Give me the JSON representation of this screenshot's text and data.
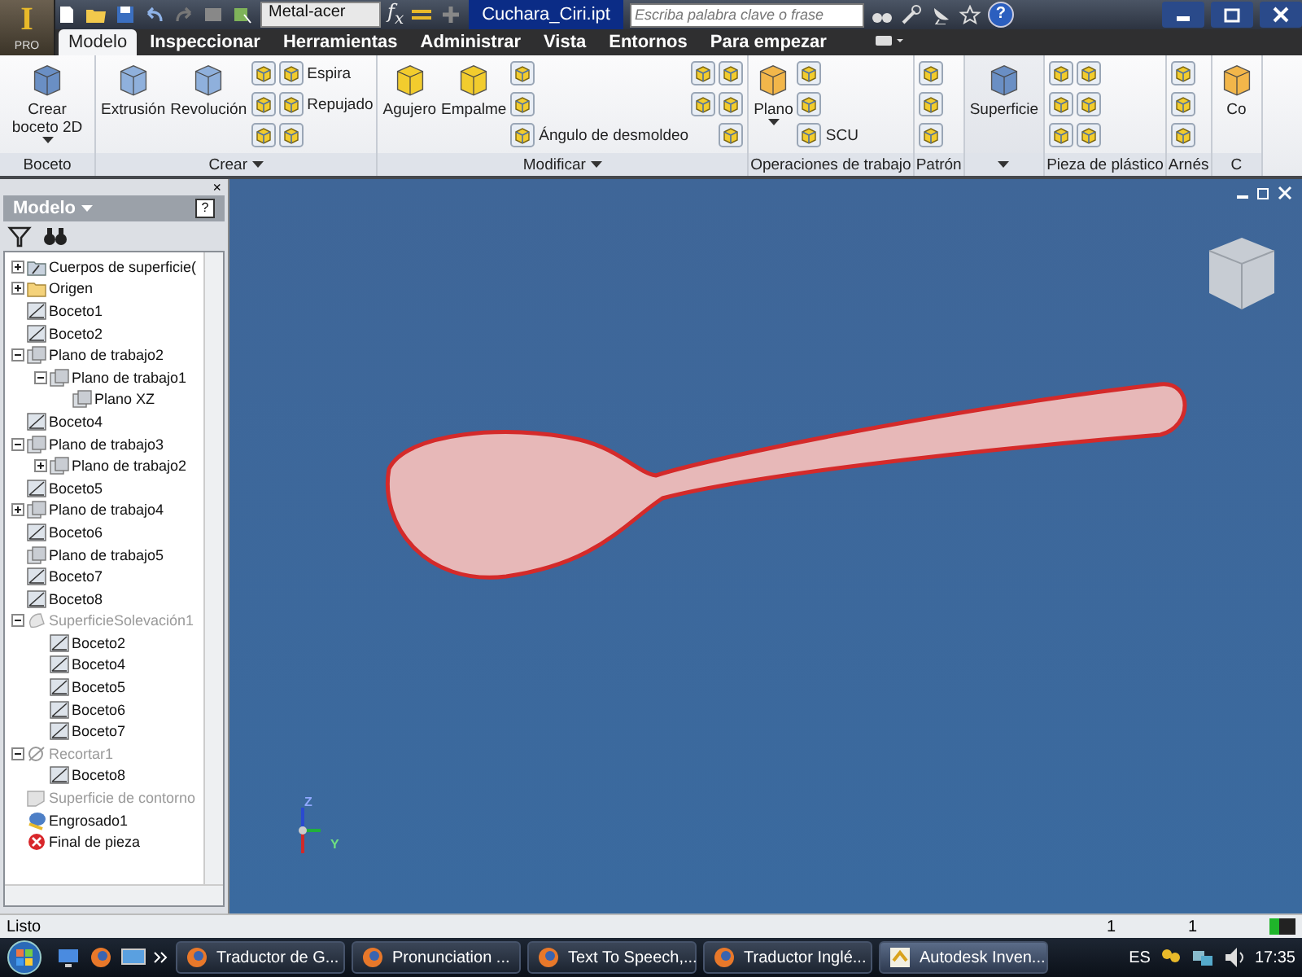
{
  "title_bar": {
    "app_logo": "I",
    "app_badge": "PRO",
    "material": "Metal-acer",
    "formula": "f$_{x}$",
    "title": "Cuchara_Ciri.ipt",
    "search": {
      "placeholder": "Escriba palabra clave o frase"
    },
    "help": "?"
  },
  "tabs": [
    {
      "label": "Modelo",
      "selected": true
    },
    {
      "label": "Inspeccionar",
      "selected": false
    },
    {
      "label": "Herramientas",
      "selected": false
    },
    {
      "label": "Administrar",
      "selected": false
    },
    {
      "label": "Vista",
      "selected": false
    },
    {
      "label": "Entornos",
      "selected": false
    },
    {
      "label": "Para empezar",
      "selected": false
    }
  ],
  "ribbon": [
    {
      "label": "Boceto",
      "menu": false,
      "highlight": false,
      "columns": [
        [
          {
            "kind": "large",
            "label": "Crear boceto 2D",
            "dropdown": true
          }
        ]
      ]
    },
    {
      "label": "Crear",
      "menu": true,
      "highlight": false,
      "columns": [
        [
          {
            "kind": "large",
            "label": "Extrusión",
            "dropdown": false
          }
        ],
        [
          {
            "kind": "large",
            "label": "Revolución",
            "dropdown": false
          }
        ],
        [
          {
            "kind": "icon"
          },
          {
            "kind": "icon"
          },
          {
            "kind": "icon"
          }
        ],
        [
          {
            "kind": "small",
            "label": "Espira"
          },
          {
            "kind": "small",
            "label": "Repujado"
          },
          {
            "kind": "icon"
          }
        ]
      ]
    },
    {
      "label": "Modificar",
      "menu": true,
      "highlight": false,
      "columns": [
        [
          {
            "kind": "large",
            "label": "Agujero",
            "dropdown": false
          }
        ],
        [
          {
            "kind": "large",
            "label": "Empalme",
            "dropdown": false
          }
        ],
        [
          {
            "kind": "icon"
          },
          {
            "kind": "icon"
          },
          {
            "kind": "small",
            "label": "Ángulo de desmoldeo"
          }
        ],
        [
          {
            "kind": "icon"
          },
          {
            "kind": "icon"
          }
        ],
        [
          {
            "kind": "icon"
          },
          {
            "kind": "icon"
          },
          {
            "kind": "icon"
          }
        ]
      ]
    },
    {
      "label": "Operaciones de trabajo",
      "menu": false,
      "highlight": false,
      "columns": [
        [
          {
            "kind": "large",
            "label": "Plano",
            "dropdown": true
          }
        ],
        [
          {
            "kind": "icon"
          },
          {
            "kind": "icon"
          },
          {
            "kind": "small",
            "label": "SCU"
          }
        ]
      ]
    },
    {
      "label": "Patrón",
      "menu": false,
      "highlight": false,
      "columns": [
        [
          {
            "kind": "icon"
          },
          {
            "kind": "icon"
          },
          {
            "kind": "icon"
          }
        ]
      ]
    },
    {
      "menu": true,
      "highlight": true,
      "columns": [
        [
          {
            "kind": "large",
            "label": "Superficie",
            "dropdown": false
          }
        ]
      ]
    },
    {
      "label": "Pieza de plástico",
      "menu": false,
      "highlight": false,
      "columns": [
        [
          {
            "kind": "icon"
          },
          {
            "kind": "icon"
          },
          {
            "kind": "icon"
          }
        ],
        [
          {
            "kind": "icon"
          },
          {
            "kind": "icon"
          },
          {
            "kind": "icon"
          }
        ]
      ]
    },
    {
      "label": "Arnés",
      "menu": false,
      "highlight": false,
      "columns": [
        [
          {
            "kind": "icon"
          },
          {
            "kind": "icon"
          },
          {
            "kind": "icon"
          }
        ]
      ]
    },
    {
      "label": "C",
      "menu": false,
      "highlight": false,
      "columns": [
        [
          {
            "kind": "large",
            "label": "Co",
            "dropdown": false
          }
        ]
      ]
    }
  ],
  "browser": {
    "close": "×",
    "title": "Modelo",
    "help": "?",
    "tree": [
      {
        "label": "Cuerpos de superficie(",
        "kind": "bodies",
        "disabled": false,
        "expanded": false
      },
      {
        "label": "Origen",
        "kind": "folder",
        "disabled": false,
        "expanded": false
      },
      {
        "label": "Boceto1",
        "kind": "sketch",
        "disabled": false
      },
      {
        "label": "Boceto2",
        "kind": "sketch",
        "disabled": false
      },
      {
        "label": "Plano de trabajo2",
        "kind": "plane",
        "disabled": false,
        "expanded": true,
        "children": [
          {
            "label": "Plano de trabajo1",
            "kind": "plane",
            "disabled": false,
            "expanded": true,
            "children": [
              {
                "label": "Plano XZ",
                "kind": "plane",
                "disabled": false
              }
            ]
          }
        ]
      },
      {
        "label": "Boceto4",
        "kind": "sketch",
        "disabled": false
      },
      {
        "label": "Plano de trabajo3",
        "kind": "plane",
        "disabled": false,
        "expanded": true,
        "children": [
          {
            "label": "Plano de trabajo2",
            "kind": "plane",
            "disabled": false,
            "expanded": false
          }
        ]
      },
      {
        "label": "Boceto5",
        "kind": "sketch",
        "disabled": false
      },
      {
        "label": "Plano de trabajo4",
        "kind": "plane",
        "disabled": false,
        "expanded": false
      },
      {
        "label": "Boceto6",
        "kind": "sketch",
        "disabled": false
      },
      {
        "label": "Plano de trabajo5",
        "kind": "plane",
        "disabled": false
      },
      {
        "label": "Boceto7",
        "kind": "sketch",
        "disabled": false
      },
      {
        "label": "Boceto8",
        "kind": "sketch",
        "disabled": false
      },
      {
        "label": "SuperficieSolevación1",
        "kind": "loft",
        "disabled": true,
        "expanded": true,
        "children": [
          {
            "label": "Boceto2",
            "kind": "sketch",
            "disabled": false
          },
          {
            "label": "Boceto4",
            "kind": "sketch",
            "disabled": false
          },
          {
            "label": "Boceto5",
            "kind": "sketch",
            "disabled": false
          },
          {
            "label": "Boceto6",
            "kind": "sketch",
            "disabled": false
          },
          {
            "label": "Boceto7",
            "kind": "sketch",
            "disabled": false
          }
        ]
      },
      {
        "label": "Recortar1",
        "kind": "trim",
        "disabled": true,
        "expanded": true,
        "children": [
          {
            "label": "Boceto8",
            "kind": "sketch",
            "disabled": false
          }
        ]
      },
      {
        "label": "Superficie de contorno",
        "kind": "surface",
        "disabled": true
      },
      {
        "label": "Engrosado1",
        "kind": "thicken",
        "disabled": false
      },
      {
        "label": "Final de pieza",
        "kind": "end",
        "disabled": false
      }
    ]
  },
  "viewport": {
    "axis_labels": [
      "Z",
      "Y"
    ]
  },
  "status_bar": {
    "message": "Listo",
    "values": [
      "1",
      "1"
    ]
  },
  "taskbar": {
    "tasks": [
      {
        "label": "Traductor de G...",
        "kind": "browser",
        "selected": false
      },
      {
        "label": "Pronunciation ...",
        "kind": "browser",
        "selected": false
      },
      {
        "label": "Text To Speech,...",
        "kind": "browser",
        "selected": false
      },
      {
        "label": "Traductor Inglé...",
        "kind": "browser",
        "selected": false
      },
      {
        "label": "Autodesk Inven...",
        "kind": "app",
        "selected": true
      }
    ],
    "language": "ES",
    "time": "17:35"
  }
}
